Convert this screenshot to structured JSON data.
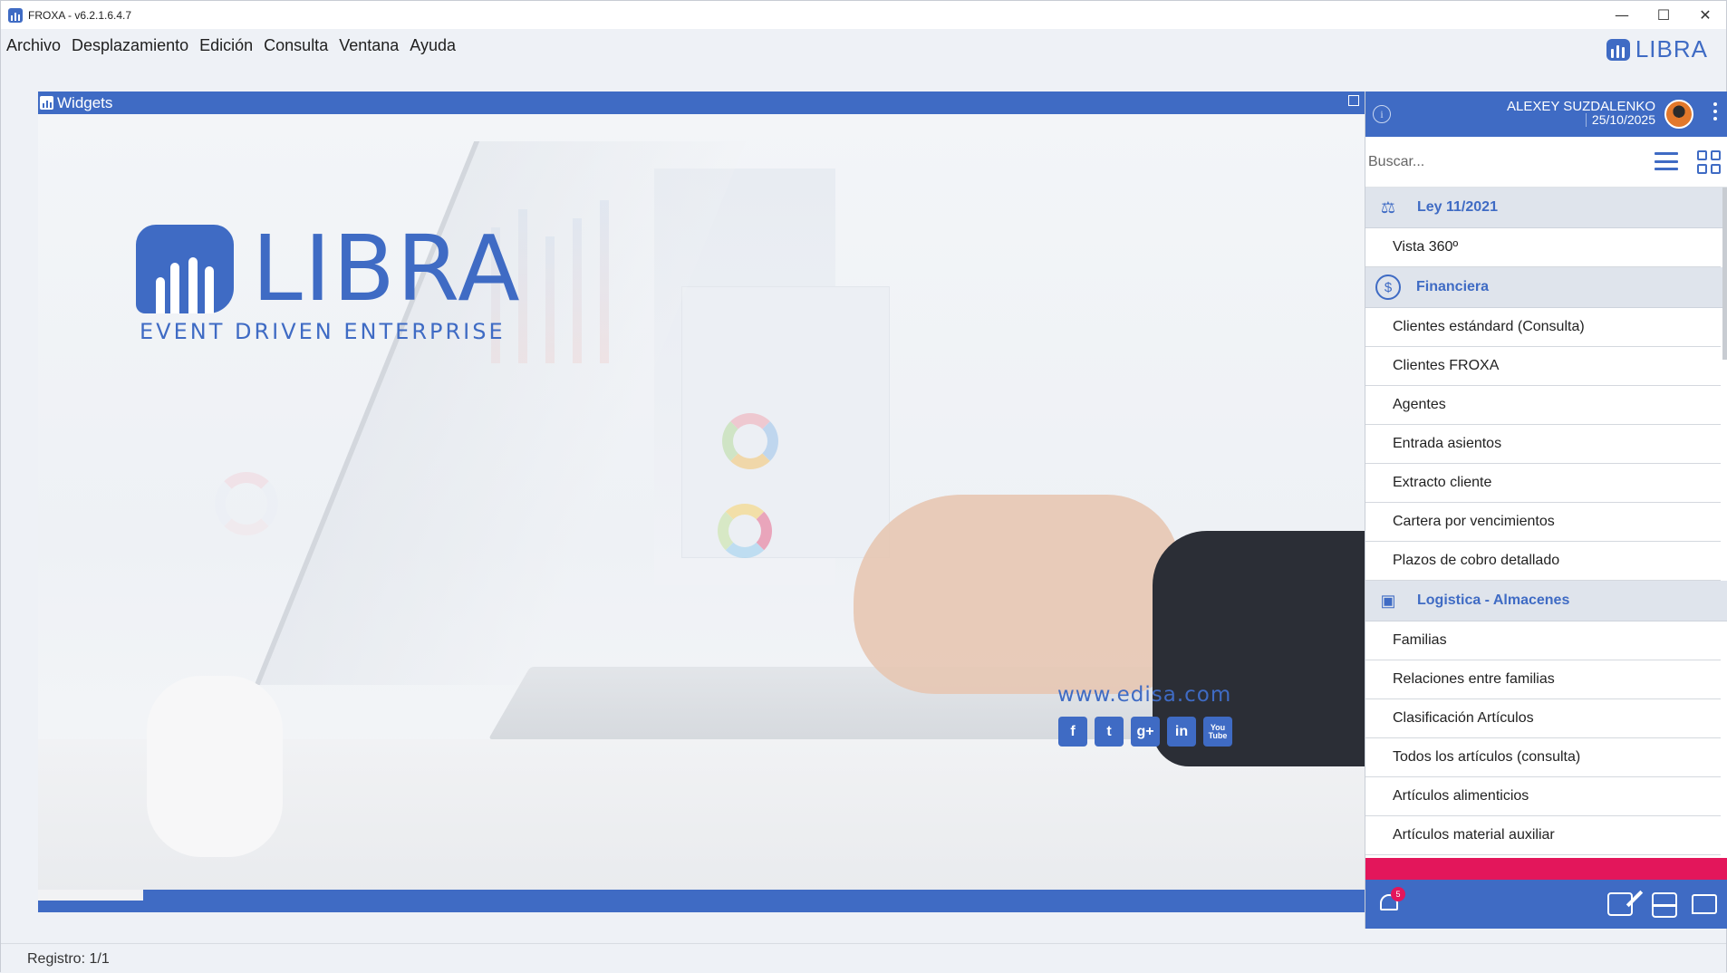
{
  "window": {
    "title": "FROXA - v6.2.1.6.4.7",
    "controls": {
      "minimize": "—",
      "maximize": "☐",
      "close": "✕"
    }
  },
  "menubar": {
    "items": [
      "Archivo",
      "Desplazamiento",
      "Edición",
      "Consulta",
      "Ventana",
      "Ayuda"
    ],
    "brand": "LIBRA"
  },
  "widgets": {
    "title": "Widgets",
    "hero": {
      "logo_word": "LIBRA",
      "tagline": "EVENT DRIVEN ENTERPRISE",
      "url": "www.edisa.com",
      "socials": [
        "f",
        "t",
        "g+",
        "in",
        "You Tube"
      ]
    }
  },
  "side": {
    "user_name": "ALEXEY SUZDALENKO",
    "date": "25/10/2025",
    "search_placeholder": "Buscar...",
    "sections": [
      {
        "icon": "law-scale-icon",
        "label": "Ley 11/2021",
        "items": [
          "Vista 360º"
        ]
      },
      {
        "icon": "dollar-icon",
        "label": "Financiera",
        "items": [
          "Clientes estándard (Consulta)",
          "Clientes FROXA",
          "Agentes",
          "Entrada asientos",
          "Extracto cliente",
          "Cartera por vencimientos",
          "Plazos de cobro detallado"
        ]
      },
      {
        "icon": "box-icon",
        "label": "Logistica - Almacenes",
        "items": [
          "Familias",
          "Relaciones entre familias",
          "Clasificación Artículos",
          "Todos los artículos (consulta)",
          "Artículos alimenticios",
          "Artículos material auxiliar"
        ]
      }
    ],
    "notifications_count": "5"
  },
  "statusbar": {
    "text": "Registro: 1/1"
  },
  "colors": {
    "brand": "#3f6bc4",
    "accent": "#e3165b"
  }
}
